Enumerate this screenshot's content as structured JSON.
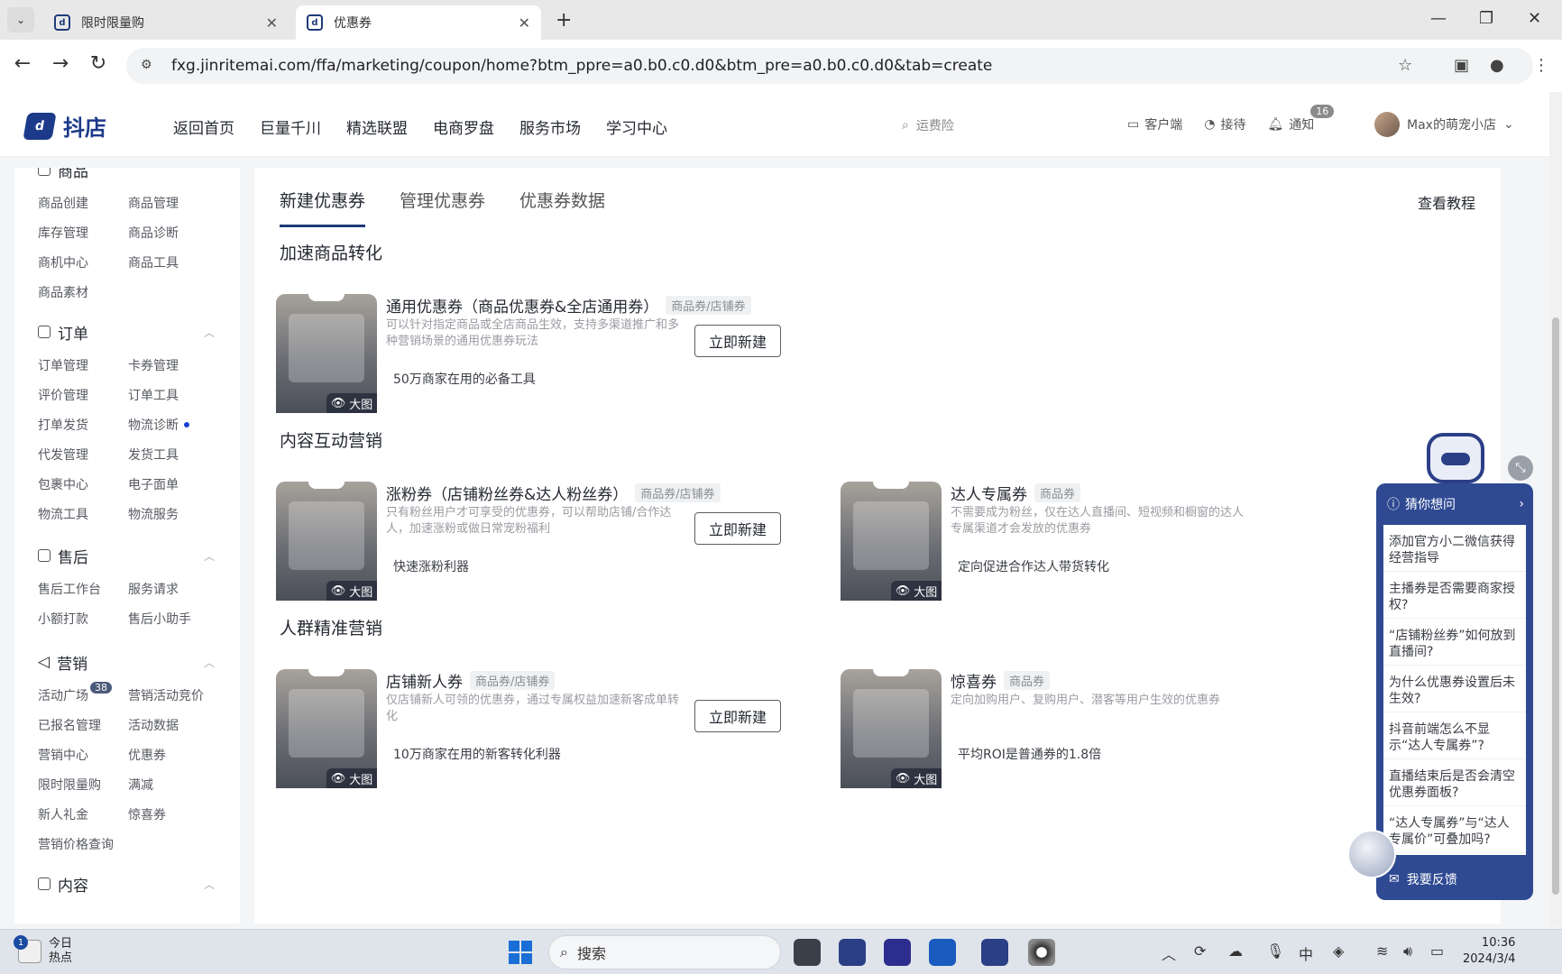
{
  "browser": {
    "tabs": [
      {
        "label": "限时限量购",
        "active": false
      },
      {
        "label": "优惠券",
        "active": true
      }
    ],
    "url": "fxg.jinritemai.com/ffa/marketing/coupon/home?btm_ppre=a0.b0.c0.d0&btm_pre=a0.b0.c0.d0&tab=create"
  },
  "header": {
    "logo": "抖店",
    "nav": [
      "返回首页",
      "巨量千川",
      "精选联盟",
      "电商罗盘",
      "服务市场",
      "学习中心"
    ],
    "search_placeholder": "运费险",
    "tools": [
      "客户端",
      "接待",
      "通知"
    ],
    "notify_count": "16",
    "user": "Max的萌宠小店"
  },
  "sidebar": {
    "partial_top": "商品",
    "product_items": [
      "商品创建",
      "商品管理",
      "库存管理",
      "商品诊断",
      "商机中心",
      "商品工具",
      "商品素材"
    ],
    "groups": [
      {
        "title": "订单",
        "items": [
          "订单管理",
          "卡券管理",
          "评价管理",
          "订单工具",
          "打单发货",
          "物流诊断",
          "代发管理",
          "发货工具",
          "包裹中心",
          "电子面单",
          "物流工具",
          "物流服务"
        ]
      },
      {
        "title": "售后",
        "items": [
          "售后工作台",
          "服务请求",
          "小额打款",
          "售后小助手"
        ]
      },
      {
        "title": "营销",
        "items": [
          "活动广场",
          "营销活动竞价",
          "已报名管理",
          "活动数据",
          "营销中心",
          "优惠券",
          "限时限量购",
          "满减",
          "新人礼金",
          "惊喜券",
          "营销价格查询"
        ]
      }
    ],
    "activity_count": "38",
    "partial_bottom": "内容"
  },
  "main": {
    "tabs": [
      "新建优惠券",
      "管理优惠券",
      "优惠券数据"
    ],
    "tutorial": "查看教程",
    "sections": [
      "加速商品转化",
      "内容互动营销",
      "人群精准营销"
    ],
    "big_image_label": "大图",
    "create_label": "立即新建",
    "cards": [
      {
        "title": "通用优惠券（商品优惠券&全店通用券）",
        "tag": "商品券/店铺券",
        "desc": "可以针对指定商品或全店商品生效，支持多渠道推广和多种营销场景的通用优惠券玩法",
        "highlight": "50万商家在用的必备工具"
      },
      {
        "title": "涨粉券（店铺粉丝券&达人粉丝券）",
        "tag": "商品券/店铺券",
        "desc": "只有粉丝用户才可享受的优惠券，可以帮助店铺/合作达人，加速涨粉或做日常宠粉福利",
        "highlight": "快速涨粉利器"
      },
      {
        "title": "达人专属券",
        "tag": "商品券",
        "desc": "不需要成为粉丝，仅在达人直播间、短视频和橱窗的达人专属渠道才会发放的优惠券",
        "highlight": "定向促进合作达人带货转化"
      },
      {
        "title": "店铺新人券",
        "tag": "商品券/店铺券",
        "desc": "仅店铺新人可领的优惠券，通过专属权益加速新客成单转化",
        "highlight": "10万商家在用的新客转化利器"
      },
      {
        "title": "惊喜券",
        "tag": "商品券",
        "desc": "定向加购用户、复购用户、潜客等用户生效的优惠券",
        "highlight": "平均ROI是普通券的1.8倍"
      }
    ]
  },
  "help": {
    "title": "猜你想问",
    "questions": [
      "添加官方小二微信获得经营指导",
      "主播券是否需要商家授权?",
      "“店铺粉丝券”如何放到直播间?",
      "为什么优惠券设置后未生效?",
      "抖音前端怎么不显示“达人专属券”?",
      "直播结束后是否会清空优惠券面板?",
      "“达人专属券”与“达人专属价”可叠加吗?"
    ],
    "feedback": "我要反馈"
  },
  "taskbar": {
    "widget_line1": "今日",
    "widget_line2": "热点",
    "widget_badge": "1",
    "search": "搜索",
    "time": "10:36",
    "date": "2024/3/4"
  }
}
